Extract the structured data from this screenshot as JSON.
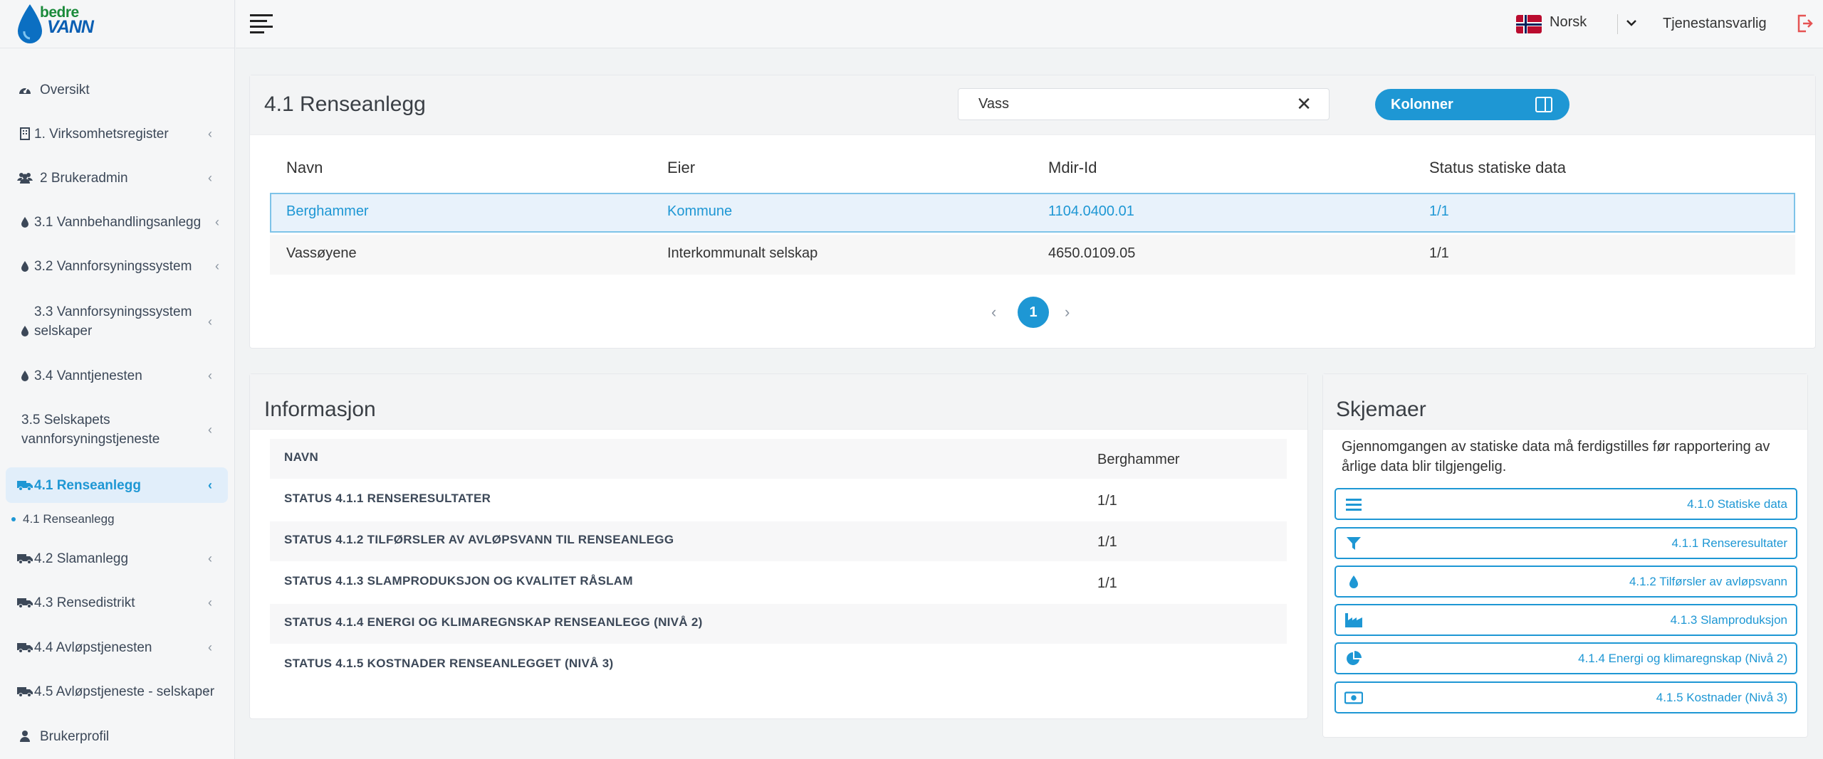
{
  "brand": {
    "line1": "bedre",
    "line2": "VANN"
  },
  "topbar": {
    "language": "Norsk",
    "role": "Tjenestansvarlig"
  },
  "sidebar": {
    "items": [
      {
        "label": "Oversikt",
        "icon": "gauge-icon"
      },
      {
        "label": "1. Virksomhetsregister",
        "icon": "building-icon"
      },
      {
        "label": "2 Brukeradmin",
        "icon": "users-icon"
      },
      {
        "label": "3.1 Vannbehandlingsanlegg",
        "icon": "droplet-icon"
      },
      {
        "label": "3.2 Vannforsyningssystem",
        "icon": "droplet-icon"
      },
      {
        "label": "3.3 Vannforsyningssystem selskaper",
        "icon": "droplet-icon"
      },
      {
        "label": "3.4 Vanntjenesten",
        "icon": "droplet-icon"
      },
      {
        "label": "3.5 Selskapets vannforsyningstjeneste",
        "icon": ""
      },
      {
        "label": "4.1 Renseanlegg",
        "icon": "truck-icon"
      },
      {
        "label": "4.2 Slamanlegg",
        "icon": "truck-icon"
      },
      {
        "label": "4.3 Rensedistrikt",
        "icon": "truck-icon"
      },
      {
        "label": "4.4 Avløpstjenesten",
        "icon": "truck-icon"
      },
      {
        "label": "4.5 Avløpstjeneste - selskaper",
        "icon": "truck-icon"
      },
      {
        "label": "Brukerprofil",
        "icon": "user-icon"
      }
    ],
    "subitem": "4.1 Renseanlegg"
  },
  "main": {
    "title": "4.1 Renseanlegg",
    "search_value": "Vass",
    "columns_button": "Kolonner",
    "table": {
      "headers": [
        "Navn",
        "Eier",
        "Mdir-Id",
        "Status statiske data"
      ],
      "rows": [
        [
          "Berghammer",
          "Kommune",
          "1104.0400.01",
          "1/1"
        ],
        [
          "Vassøyene",
          "Interkommunalt selskap",
          "4650.0109.05",
          "1/1"
        ]
      ]
    },
    "pagination": {
      "current": "1"
    }
  },
  "info": {
    "title": "Informasjon",
    "rows": [
      {
        "label": "NAVN",
        "value": "Berghammer"
      },
      {
        "label": "STATUS 4.1.1 RENSERESULTATER",
        "value": "1/1"
      },
      {
        "label": "STATUS 4.1.2 TILFØRSLER AV AVLØPSVANN TIL RENSEANLEGG",
        "value": "1/1"
      },
      {
        "label": "STATUS 4.1.3 SLAMPRODUKSJON OG KVALITET RÅSLAM",
        "value": "1/1"
      },
      {
        "label": "STATUS 4.1.4 ENERGI OG KLIMAREGNSKAP RENSEANLEGG (NIVÅ 2)",
        "value": ""
      },
      {
        "label": "STATUS 4.1.5 KOSTNADER RENSEANLEGGET (NIVÅ 3)",
        "value": ""
      }
    ]
  },
  "skjemaer": {
    "title": "Skjemaer",
    "text": "Gjennomgangen av statiske data må ferdigstilles før rapportering av årlige data blir tilgjengelig.",
    "buttons": [
      {
        "label": "4.1.0 Statiske data",
        "icon": "list-icon"
      },
      {
        "label": "4.1.1 Renseresultater",
        "icon": "filter-icon"
      },
      {
        "label": "4.1.2 Tilførsler av avløpsvann",
        "icon": "droplet-icon"
      },
      {
        "label": "4.1.3 Slamproduksjon",
        "icon": "industry-icon"
      },
      {
        "label": "4.1.4 Energi og klimaregnskap (Nivå 2)",
        "icon": "pie-chart-icon"
      },
      {
        "label": "4.1.5 Kostnader (Nivå 3)",
        "icon": "money-icon"
      }
    ]
  },
  "colors": {
    "accent": "#1e97d4",
    "active_bg": "#e1eefa"
  }
}
